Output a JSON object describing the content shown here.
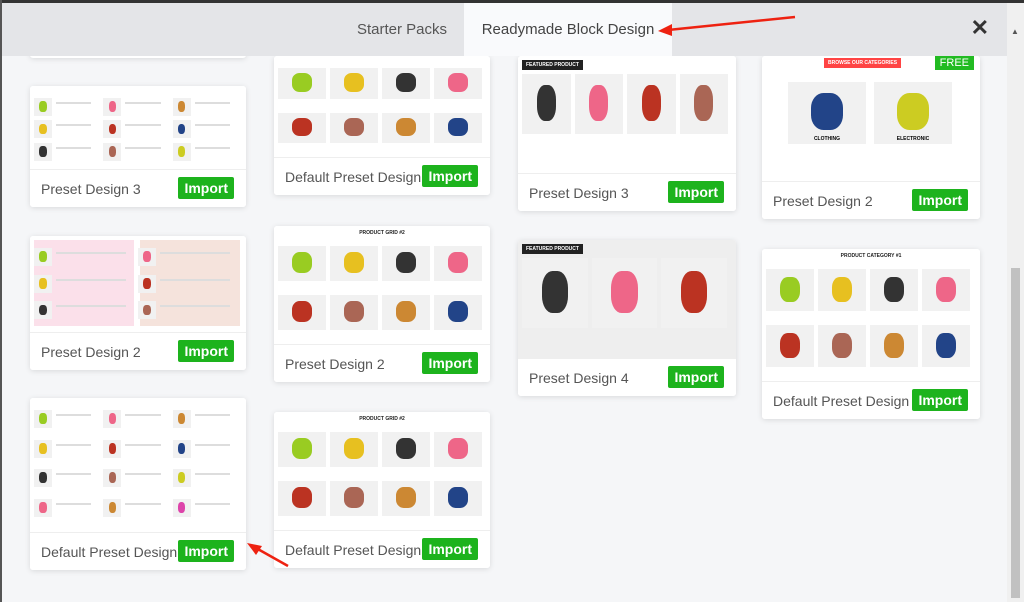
{
  "header": {
    "tabs": [
      {
        "label": "Starter Packs",
        "active": false
      },
      {
        "label": "Readymade Block Design",
        "active": true
      }
    ],
    "close_icon": "close-icon"
  },
  "import_label": "Import",
  "accent": "#1db31d",
  "cards": [
    {
      "col": 0,
      "label": "Preset Design 3",
      "thumb": "list3"
    },
    {
      "col": 0,
      "label": "Preset Design 2",
      "thumb": "pink"
    },
    {
      "col": 0,
      "label": "Default Preset Design",
      "thumb": "list3tall"
    },
    {
      "col": 1,
      "label": "Default Preset Design",
      "thumb": "grid"
    },
    {
      "col": 1,
      "label": "Preset Design 2",
      "thumb": "grid2",
      "title": "PRODUCT GRID #2"
    },
    {
      "col": 1,
      "label": "Default Preset Design",
      "thumb": "grid",
      "title": "PRODUCT GRID #2"
    },
    {
      "col": 2,
      "label": "Preset Design 3",
      "thumb": "featured",
      "title": "FEATURED PRODUCT"
    },
    {
      "col": 2,
      "label": "Preset Design 4",
      "thumb": "featured4",
      "title": "FEATURED PRODUCT"
    },
    {
      "col": 3,
      "label": "Preset Design 2",
      "thumb": "cats",
      "title": "BROWSE OUR CATEGORIES",
      "badge": "FREE",
      "cats": [
        "CLOTHING",
        "ELECTRONIC"
      ]
    },
    {
      "col": 3,
      "label": "Default Preset Design",
      "thumb": "cat1",
      "title": "PRODUCT CATEGORY #1"
    }
  ]
}
